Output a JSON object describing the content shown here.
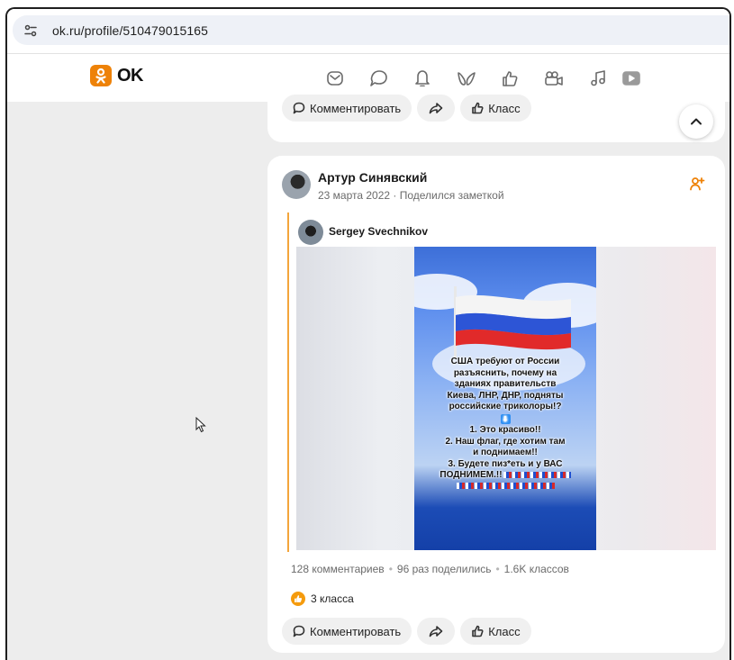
{
  "browser": {
    "url": "ok.ru/profile/510479015165"
  },
  "app": {
    "logo_text": "OK",
    "brand_color": "#ee8208",
    "nav_icons": [
      "messages-icon",
      "discussions-icon",
      "notifications-icon",
      "guests-icon",
      "events-icon",
      "video-icon",
      "music-icon"
    ]
  },
  "top_post": {
    "actions": {
      "comment_label": "Комментировать",
      "class_label": "Класс"
    }
  },
  "post": {
    "author": "Артур Синявский",
    "meta": "23 марта 2022 · Поделился заметкой",
    "shared": {
      "author": "Sergey Svechnikov",
      "poster_lines": [
        "США требуют от России",
        "разъяснить, почему на",
        "зданиях правительств",
        "Киева, ЛНР, ДНР, подняты",
        "российские триколоры!?",
        "1. Это красиво!!",
        "2. Наш флаг, где хотим там",
        "и поднимаем!!",
        "3. Будете пиз*еть и у ВАС",
        "ПОДНИМЕМ.!!"
      ],
      "arrow_glyph": "⬇"
    },
    "stats": {
      "comments": "128 комментариев",
      "shares": "96 раз поделились",
      "classes": "1.6K классов"
    },
    "likes": "3 класса",
    "actions": {
      "comment_label": "Комментировать",
      "class_label": "Класс"
    }
  }
}
